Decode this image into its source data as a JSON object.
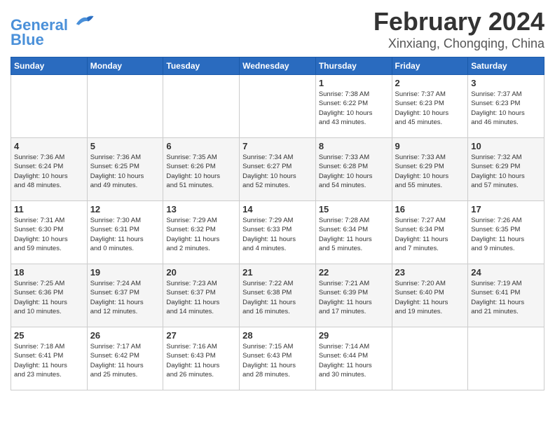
{
  "header": {
    "logo_line1": "General",
    "logo_line2": "Blue",
    "month": "February 2024",
    "location": "Xinxiang, Chongqing, China"
  },
  "weekdays": [
    "Sunday",
    "Monday",
    "Tuesday",
    "Wednesday",
    "Thursday",
    "Friday",
    "Saturday"
  ],
  "weeks": [
    [
      {
        "day": "",
        "info": ""
      },
      {
        "day": "",
        "info": ""
      },
      {
        "day": "",
        "info": ""
      },
      {
        "day": "",
        "info": ""
      },
      {
        "day": "1",
        "info": "Sunrise: 7:38 AM\nSunset: 6:22 PM\nDaylight: 10 hours\nand 43 minutes."
      },
      {
        "day": "2",
        "info": "Sunrise: 7:37 AM\nSunset: 6:23 PM\nDaylight: 10 hours\nand 45 minutes."
      },
      {
        "day": "3",
        "info": "Sunrise: 7:37 AM\nSunset: 6:23 PM\nDaylight: 10 hours\nand 46 minutes."
      }
    ],
    [
      {
        "day": "4",
        "info": "Sunrise: 7:36 AM\nSunset: 6:24 PM\nDaylight: 10 hours\nand 48 minutes."
      },
      {
        "day": "5",
        "info": "Sunrise: 7:36 AM\nSunset: 6:25 PM\nDaylight: 10 hours\nand 49 minutes."
      },
      {
        "day": "6",
        "info": "Sunrise: 7:35 AM\nSunset: 6:26 PM\nDaylight: 10 hours\nand 51 minutes."
      },
      {
        "day": "7",
        "info": "Sunrise: 7:34 AM\nSunset: 6:27 PM\nDaylight: 10 hours\nand 52 minutes."
      },
      {
        "day": "8",
        "info": "Sunrise: 7:33 AM\nSunset: 6:28 PM\nDaylight: 10 hours\nand 54 minutes."
      },
      {
        "day": "9",
        "info": "Sunrise: 7:33 AM\nSunset: 6:29 PM\nDaylight: 10 hours\nand 55 minutes."
      },
      {
        "day": "10",
        "info": "Sunrise: 7:32 AM\nSunset: 6:29 PM\nDaylight: 10 hours\nand 57 minutes."
      }
    ],
    [
      {
        "day": "11",
        "info": "Sunrise: 7:31 AM\nSunset: 6:30 PM\nDaylight: 10 hours\nand 59 minutes."
      },
      {
        "day": "12",
        "info": "Sunrise: 7:30 AM\nSunset: 6:31 PM\nDaylight: 11 hours\nand 0 minutes."
      },
      {
        "day": "13",
        "info": "Sunrise: 7:29 AM\nSunset: 6:32 PM\nDaylight: 11 hours\nand 2 minutes."
      },
      {
        "day": "14",
        "info": "Sunrise: 7:29 AM\nSunset: 6:33 PM\nDaylight: 11 hours\nand 4 minutes."
      },
      {
        "day": "15",
        "info": "Sunrise: 7:28 AM\nSunset: 6:34 PM\nDaylight: 11 hours\nand 5 minutes."
      },
      {
        "day": "16",
        "info": "Sunrise: 7:27 AM\nSunset: 6:34 PM\nDaylight: 11 hours\nand 7 minutes."
      },
      {
        "day": "17",
        "info": "Sunrise: 7:26 AM\nSunset: 6:35 PM\nDaylight: 11 hours\nand 9 minutes."
      }
    ],
    [
      {
        "day": "18",
        "info": "Sunrise: 7:25 AM\nSunset: 6:36 PM\nDaylight: 11 hours\nand 10 minutes."
      },
      {
        "day": "19",
        "info": "Sunrise: 7:24 AM\nSunset: 6:37 PM\nDaylight: 11 hours\nand 12 minutes."
      },
      {
        "day": "20",
        "info": "Sunrise: 7:23 AM\nSunset: 6:37 PM\nDaylight: 11 hours\nand 14 minutes."
      },
      {
        "day": "21",
        "info": "Sunrise: 7:22 AM\nSunset: 6:38 PM\nDaylight: 11 hours\nand 16 minutes."
      },
      {
        "day": "22",
        "info": "Sunrise: 7:21 AM\nSunset: 6:39 PM\nDaylight: 11 hours\nand 17 minutes."
      },
      {
        "day": "23",
        "info": "Sunrise: 7:20 AM\nSunset: 6:40 PM\nDaylight: 11 hours\nand 19 minutes."
      },
      {
        "day": "24",
        "info": "Sunrise: 7:19 AM\nSunset: 6:41 PM\nDaylight: 11 hours\nand 21 minutes."
      }
    ],
    [
      {
        "day": "25",
        "info": "Sunrise: 7:18 AM\nSunset: 6:41 PM\nDaylight: 11 hours\nand 23 minutes."
      },
      {
        "day": "26",
        "info": "Sunrise: 7:17 AM\nSunset: 6:42 PM\nDaylight: 11 hours\nand 25 minutes."
      },
      {
        "day": "27",
        "info": "Sunrise: 7:16 AM\nSunset: 6:43 PM\nDaylight: 11 hours\nand 26 minutes."
      },
      {
        "day": "28",
        "info": "Sunrise: 7:15 AM\nSunset: 6:43 PM\nDaylight: 11 hours\nand 28 minutes."
      },
      {
        "day": "29",
        "info": "Sunrise: 7:14 AM\nSunset: 6:44 PM\nDaylight: 11 hours\nand 30 minutes."
      },
      {
        "day": "",
        "info": ""
      },
      {
        "day": "",
        "info": ""
      }
    ]
  ]
}
